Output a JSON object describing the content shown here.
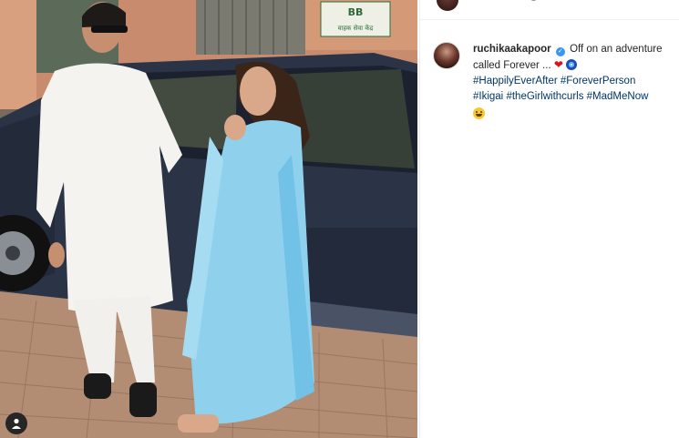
{
  "post": {
    "photo_sign_text": "वाहक सेवा केंद्र",
    "sign_logo_text": "BB"
  },
  "comment": {
    "username": "ruchikaakapoor",
    "text_prefix": "Off on an adventure called Forever ...",
    "hashtags": [
      "#HappilyEverAfter",
      "#ForeverPerson",
      "#Ikigai",
      "#theGirlwithcurls",
      "#MadMeNow"
    ]
  },
  "icons": {
    "verified": "verified-badge-icon",
    "heart": "red-heart-emoji",
    "nazar": "nazar-amulet-emoji",
    "face": "zany-face-emoji",
    "user_tags": "user-tag-icon"
  },
  "colors": {
    "hashtag": "#003569",
    "verified": "#3897f0",
    "text": "#262626"
  }
}
